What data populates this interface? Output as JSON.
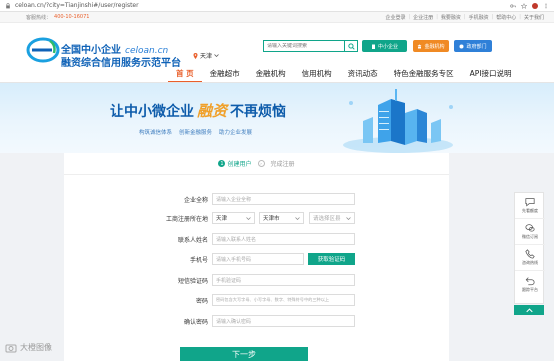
{
  "browser": {
    "url": "celoan.cn/?city=Tianjinshi#/user/register"
  },
  "top_strip": {
    "hotline_label": "客服热线：",
    "hotline_number": "400-10-16071",
    "links": [
      "企业登录",
      "企业注册",
      "我要融资",
      "手机融资",
      "帮助中心",
      "关于我们"
    ]
  },
  "header": {
    "logo_line1": "全国中小企业",
    "logo_domain": "celoan.cn",
    "logo_line2": "融资综合信用服务示范平台",
    "city": "天津",
    "search_placeholder": "请输入关键词搜索",
    "buttons": [
      "中小企业",
      "金融机构",
      "政府部门"
    ]
  },
  "nav": {
    "items": [
      "首 页",
      "金融超市",
      "金融机构",
      "信用机构",
      "资讯动态",
      "特色金融服务专区",
      "API接口说明"
    ]
  },
  "banner": {
    "title_pre": "让中小微企业",
    "title_accent": "融资",
    "title_post": "不再烦恼",
    "sub": [
      "构筑诚信体系",
      "创新金融服务",
      "助力企业发展"
    ]
  },
  "steps": {
    "step1_num": "1",
    "step1": "创建用户",
    "step2": "完成注册"
  },
  "form": {
    "company_label": "企业全称",
    "company_placeholder": "请输入企业全称",
    "region_label": "工商注册所在地",
    "region_province": "天津",
    "region_city": "天津市",
    "region_district": "请选择区县",
    "contact_label": "联系人姓名",
    "contact_placeholder": "请输入联系人姓名",
    "phone_label": "手机号",
    "phone_placeholder": "请输入手机号码",
    "get_code": "获取验证码",
    "sms_label": "短信验证码",
    "sms_placeholder": "手机验证码",
    "password_label": "密码",
    "password_placeholder": "密码包含大写字母、小写字母、数字、特殊符号中的三种以上",
    "confirm_label": "确认密码",
    "confirm_placeholder": "请输入确认密码",
    "next": "下一步"
  },
  "side_panel": {
    "items": [
      "先看额度",
      "微信订阅",
      "咨询热线",
      "跟踪平台"
    ]
  },
  "watermark": "大橙图像",
  "colors": {
    "primary": "#10a58a",
    "brand_blue": "#0f62b7",
    "accent_orange": "#e95f2b"
  }
}
